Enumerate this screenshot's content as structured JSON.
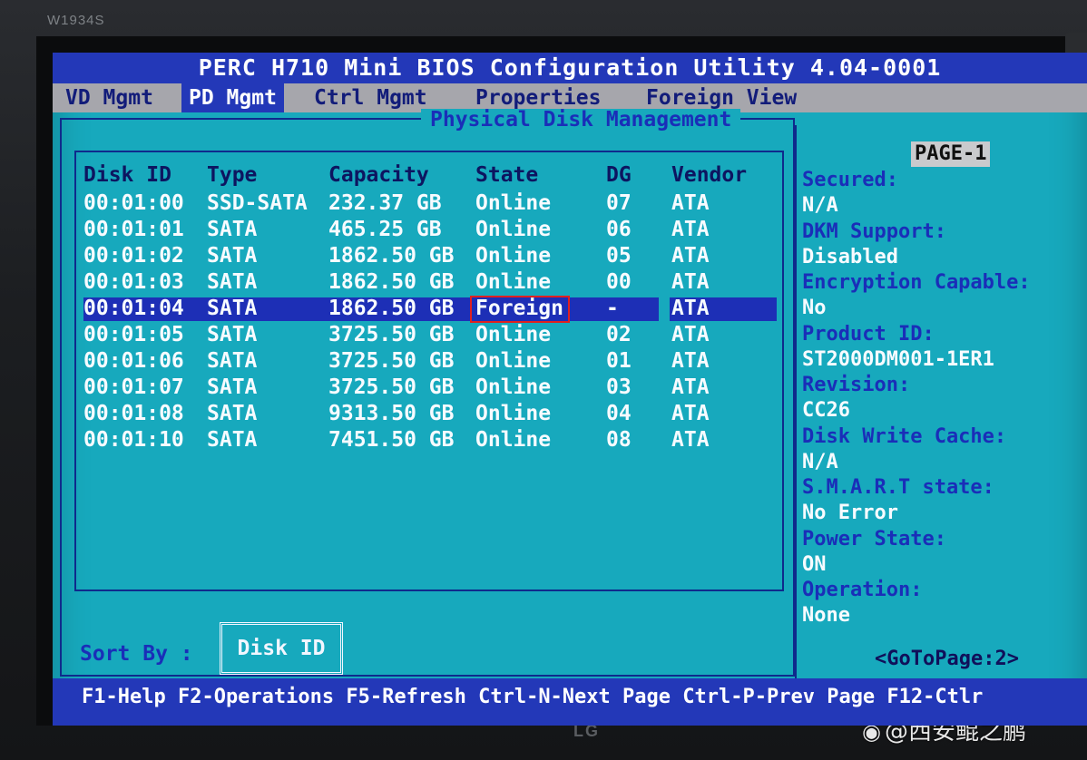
{
  "monitor": {
    "model": "W1934S",
    "brand": "LG",
    "watermark": "@西安鲲之鹏"
  },
  "bios": {
    "title": "PERC H710 Mini BIOS Configuration Utility 4.04-0001",
    "tabs": [
      {
        "label": "VD Mgmt",
        "active": false
      },
      {
        "label": "PD Mgmt",
        "active": true
      },
      {
        "label": "Ctrl Mgmt",
        "active": false
      },
      {
        "label": "Properties",
        "active": false
      },
      {
        "label": "Foreign View",
        "active": false
      }
    ],
    "panel_title": "Physical Disk Management",
    "table": {
      "headers": [
        "Disk ID",
        "Type",
        "Capacity",
        "State",
        "DG",
        "Vendor"
      ],
      "rows": [
        [
          "00:01:00",
          "SSD-SATA",
          "232.37 GB",
          "Online",
          "07",
          "ATA"
        ],
        [
          "00:01:01",
          "SATA",
          "465.25 GB",
          "Online",
          "06",
          "ATA"
        ],
        [
          "00:01:02",
          "SATA",
          "1862.50 GB",
          "Online",
          "05",
          "ATA"
        ],
        [
          "00:01:03",
          "SATA",
          "1862.50 GB",
          "Online",
          "00",
          "ATA"
        ],
        [
          "00:01:04",
          "SATA",
          "1862.50 GB",
          "Foreign",
          "-",
          "ATA"
        ],
        [
          "00:01:05",
          "SATA",
          "3725.50 GB",
          "Online",
          "02",
          "ATA"
        ],
        [
          "00:01:06",
          "SATA",
          "3725.50 GB",
          "Online",
          "01",
          "ATA"
        ],
        [
          "00:01:07",
          "SATA",
          "3725.50 GB",
          "Online",
          "03",
          "ATA"
        ],
        [
          "00:01:08",
          "SATA",
          "9313.50 GB",
          "Online",
          "04",
          "ATA"
        ],
        [
          "00:01:10",
          "SATA",
          "7451.50 GB",
          "Online",
          "08",
          "ATA"
        ]
      ],
      "selected_row": 4
    },
    "sort": {
      "label": "Sort By :",
      "value": "Disk ID"
    },
    "info": {
      "page": "PAGE-1",
      "fields": [
        {
          "label": "Secured:",
          "value": "N/A"
        },
        {
          "label": "DKM Support:",
          "value": "Disabled"
        },
        {
          "label": "Encryption Capable:",
          "value": "No"
        },
        {
          "label": "Product ID:",
          "value": "ST2000DM001-1ER1"
        },
        {
          "label": "Revision:",
          "value": "CC26"
        },
        {
          "label": "Disk Write Cache:",
          "value": "N/A"
        },
        {
          "label": "S.M.A.R.T state:",
          "value": "No Error"
        },
        {
          "label": "Power State:",
          "value": "ON"
        },
        {
          "label": "Operation:",
          "value": "None"
        }
      ],
      "goto": "<GoToPage:2>"
    },
    "footer": "F1-Help F2-Operations F5-Refresh Ctrl-N-Next Page Ctrl-P-Prev Page F12-Ctlr"
  },
  "colors": {
    "screen_bg": "#17a9bd",
    "title_bar": "#2338b8",
    "selection": "#1d2fb6",
    "label_blue": "#1a2eb8",
    "highlight_box": "#e02020"
  }
}
